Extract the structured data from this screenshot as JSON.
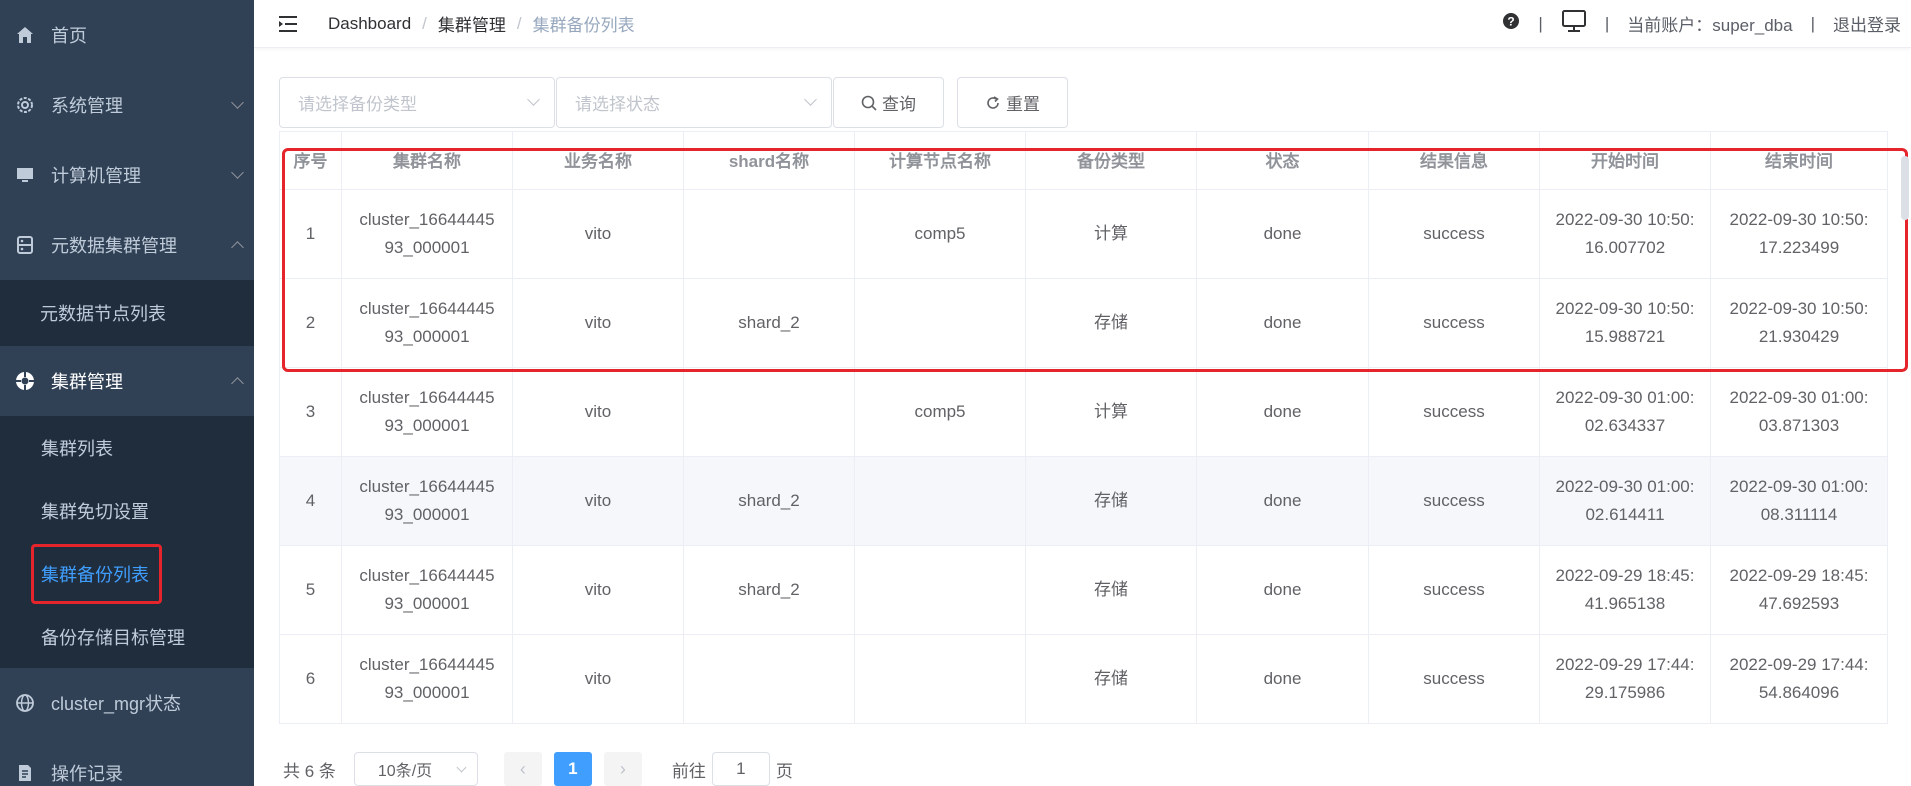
{
  "sidebar": {
    "items": [
      {
        "label": "首页",
        "icon": "home-icon"
      },
      {
        "label": "系统管理",
        "icon": "gear-icon"
      },
      {
        "label": "计算机管理",
        "icon": "monitor-icon"
      },
      {
        "label": "元数据集群管理",
        "icon": "server-icon"
      },
      {
        "label": "元数据节点列表"
      },
      {
        "label": "集群管理",
        "icon": "cluster-icon"
      },
      {
        "label": "集群列表"
      },
      {
        "label": "集群免切设置"
      },
      {
        "label": "集群备份列表"
      },
      {
        "label": "备份存储目标管理"
      },
      {
        "label": "cluster_mgr状态",
        "icon": "globe-icon"
      },
      {
        "label": "操作记录",
        "icon": "log-icon"
      }
    ]
  },
  "navbar": {
    "breadcrumb": [
      "Dashboard",
      "集群管理",
      "集群备份列表"
    ],
    "account_label": "当前账户：super_dba",
    "logout_label": "退出登录",
    "separator": "|",
    "breadcrumb_sep": "/"
  },
  "filters": {
    "backup_type_placeholder": "请选择备份类型",
    "status_placeholder": "请选择状态",
    "query_label": "查询",
    "reset_label": "重置"
  },
  "table": {
    "columns": [
      "序号",
      "集群名称",
      "业务名称",
      "shard名称",
      "计算节点名称",
      "备份类型",
      "状态",
      "结果信息",
      "开始时间",
      "结束时间"
    ],
    "rows": [
      [
        "1",
        "cluster_1664444593_000001",
        "vito",
        "",
        "comp5",
        "计算",
        "done",
        "success",
        "2022-09-30 10:50:16.007702",
        "2022-09-30 10:50:17.223499"
      ],
      [
        "2",
        "cluster_1664444593_000001",
        "vito",
        "shard_2",
        "",
        "存储",
        "done",
        "success",
        "2022-09-30 10:50:15.988721",
        "2022-09-30 10:50:21.930429"
      ],
      [
        "3",
        "cluster_1664444593_000001",
        "vito",
        "",
        "comp5",
        "计算",
        "done",
        "success",
        "2022-09-30 01:00:02.634337",
        "2022-09-30 01:00:03.871303"
      ],
      [
        "4",
        "cluster_1664444593_000001",
        "vito",
        "shard_2",
        "",
        "存储",
        "done",
        "success",
        "2022-09-30 01:00:02.614411",
        "2022-09-30 01:00:08.311114"
      ],
      [
        "5",
        "cluster_1664444593_000001",
        "vito",
        "shard_2",
        "",
        "存储",
        "done",
        "success",
        "2022-09-29 18:45:41.965138",
        "2022-09-29 18:45:47.692593"
      ],
      [
        "6",
        "cluster_1664444593_000001",
        "vito",
        "",
        "",
        "存储",
        "done",
        "success",
        "2022-09-29 17:44:29.175986",
        "2022-09-29 17:44:54.864096"
      ]
    ],
    "row_display": [
      [
        [
          "1"
        ],
        [
          "cluster_16644445",
          "93_000001"
        ],
        [
          "vito"
        ],
        [
          ""
        ],
        [
          "comp5"
        ],
        [
          "计算"
        ],
        [
          "done"
        ],
        [
          "success"
        ],
        [
          "2022-09-30 10:50:",
          "16.007702"
        ],
        [
          "2022-09-30 10:50:",
          "17.223499"
        ]
      ],
      [
        [
          "2"
        ],
        [
          "cluster_16644445",
          "93_000001"
        ],
        [
          "vito"
        ],
        [
          "shard_2"
        ],
        [
          ""
        ],
        [
          "存储"
        ],
        [
          "done"
        ],
        [
          "success"
        ],
        [
          "2022-09-30 10:50:",
          "15.988721"
        ],
        [
          "2022-09-30 10:50:",
          "21.930429"
        ]
      ],
      [
        [
          "3"
        ],
        [
          "cluster_16644445",
          "93_000001"
        ],
        [
          "vito"
        ],
        [
          ""
        ],
        [
          "comp5"
        ],
        [
          "计算"
        ],
        [
          "done"
        ],
        [
          "success"
        ],
        [
          "2022-09-30 01:00:",
          "02.634337"
        ],
        [
          "2022-09-30 01:00:",
          "03.871303"
        ]
      ],
      [
        [
          "4"
        ],
        [
          "cluster_16644445",
          "93_000001"
        ],
        [
          "vito"
        ],
        [
          "shard_2"
        ],
        [
          ""
        ],
        [
          "存储"
        ],
        [
          "done"
        ],
        [
          "success"
        ],
        [
          "2022-09-30 01:00:",
          "02.614411"
        ],
        [
          "2022-09-30 01:00:",
          "08.311114"
        ]
      ],
      [
        [
          "5"
        ],
        [
          "cluster_16644445",
          "93_000001"
        ],
        [
          "vito"
        ],
        [
          "shard_2"
        ],
        [
          ""
        ],
        [
          "存储"
        ],
        [
          "done"
        ],
        [
          "success"
        ],
        [
          "2022-09-29 18:45:",
          "41.965138"
        ],
        [
          "2022-09-29 18:45:",
          "47.692593"
        ]
      ],
      [
        [
          "6"
        ],
        [
          "cluster_16644445",
          "93_000001"
        ],
        [
          "vito"
        ],
        [
          ""
        ],
        [
          ""
        ],
        [
          "存储"
        ],
        [
          "done"
        ],
        [
          "success"
        ],
        [
          "2022-09-29 17:44:",
          "29.175986"
        ],
        [
          "2022-09-29 17:44:",
          "54.864096"
        ]
      ]
    ]
  },
  "pagination": {
    "total_label": "共 6 条",
    "page_size_label": "10条/页",
    "current_page": "1",
    "goto_prefix": "前往",
    "goto_value": "1",
    "goto_suffix": "页",
    "prev_glyph": "‹",
    "next_glyph": "›"
  },
  "colors": {
    "sidebar_bg": "#304156",
    "submenu_bg": "#1f2d3d",
    "accent": "#409eff",
    "highlight_border": "#e5242b"
  }
}
